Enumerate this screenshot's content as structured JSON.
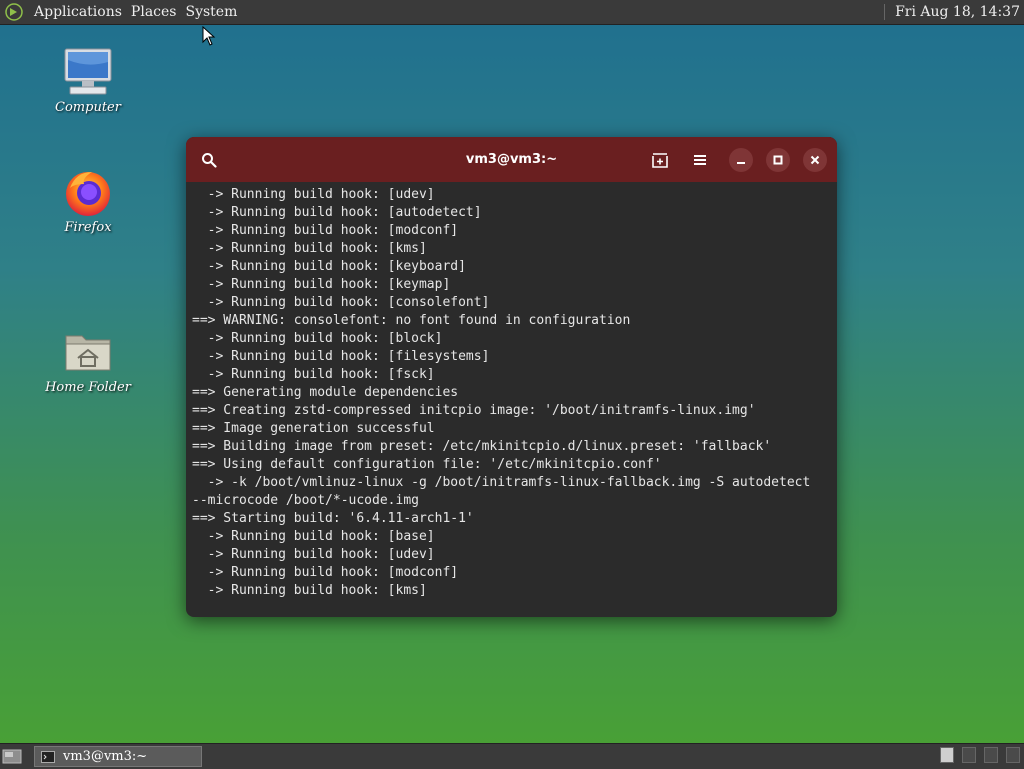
{
  "top_panel": {
    "menus": [
      "Applications",
      "Places",
      "System"
    ],
    "clock": "Fri Aug 18, 14:37"
  },
  "desktop_icons": {
    "computer": "Computer",
    "firefox": "Firefox",
    "home": "Home Folder"
  },
  "terminal": {
    "title": "vm3@vm3:~",
    "lines": [
      "  -> Running build hook: [udev]",
      "  -> Running build hook: [autodetect]",
      "  -> Running build hook: [modconf]",
      "  -> Running build hook: [kms]",
      "  -> Running build hook: [keyboard]",
      "  -> Running build hook: [keymap]",
      "  -> Running build hook: [consolefont]",
      "==> WARNING: consolefont: no font found in configuration",
      "  -> Running build hook: [block]",
      "  -> Running build hook: [filesystems]",
      "  -> Running build hook: [fsck]",
      "==> Generating module dependencies",
      "==> Creating zstd-compressed initcpio image: '/boot/initramfs-linux.img'",
      "==> Image generation successful",
      "==> Building image from preset: /etc/mkinitcpio.d/linux.preset: 'fallback'",
      "==> Using default configuration file: '/etc/mkinitcpio.conf'",
      "  -> -k /boot/vmlinuz-linux -g /boot/initramfs-linux-fallback.img -S autodetect",
      "--microcode /boot/*-ucode.img",
      "==> Starting build: '6.4.11-arch1-1'",
      "  -> Running build hook: [base]",
      "  -> Running build hook: [udev]",
      "  -> Running build hook: [modconf]",
      "  -> Running build hook: [kms]"
    ]
  },
  "taskbar": {
    "task_label": "vm3@vm3:~"
  },
  "colors": {
    "titlebar": "#6a1f20",
    "terminal_bg": "#2b2b2b",
    "panel": "#3a3a3a"
  }
}
